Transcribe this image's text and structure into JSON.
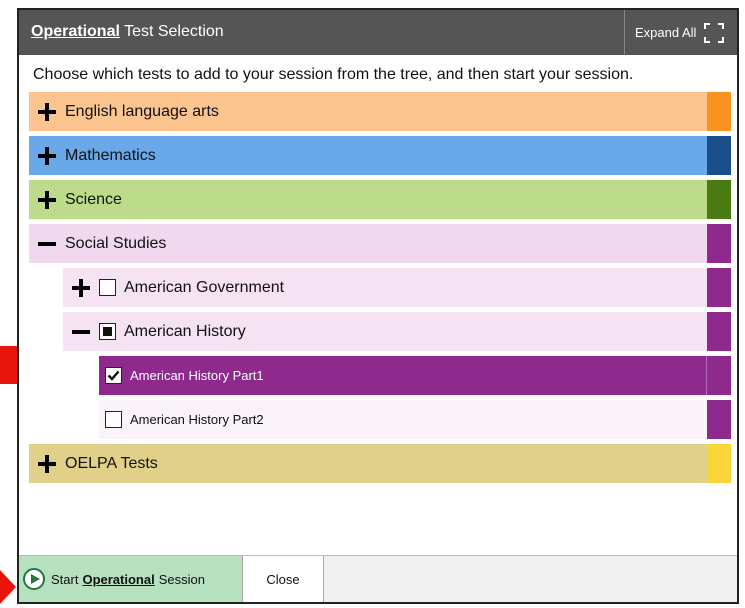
{
  "dialog": {
    "title_prefix": "Operational",
    "title_suffix": " Test Selection",
    "expand_all_label": "Expand All",
    "instructions": "Choose which tests to add to your session from the tree, and then start your session."
  },
  "tree": {
    "ela": {
      "label": "English language arts",
      "bg": "#fcc590",
      "accent": "#f7931e"
    },
    "math": {
      "label": "Mathematics",
      "bg": "#6aa9e9",
      "accent": "#1a4f8b"
    },
    "science": {
      "label": "Science",
      "bg": "#bcdc8c",
      "accent": "#4a7a12"
    },
    "social": {
      "label": "Social Studies",
      "bg": "#f0d9ee",
      "accent": "#8e2a8e"
    },
    "american_government": {
      "label": "American Government"
    },
    "american_history": {
      "label": "American History"
    },
    "ah_part1": {
      "label": "American History Part1",
      "selected_bg": "#8e2a8e"
    },
    "ah_part2": {
      "label": "American History Part2"
    },
    "oelpa": {
      "label": "OELPA Tests",
      "bg": "#e0d08a",
      "accent": "#f9d43a"
    }
  },
  "footer": {
    "start_prefix": "Start ",
    "start_emph": "Operational",
    "start_suffix": " Session",
    "close_label": "Close"
  },
  "colors": {
    "titlebar": "#555555",
    "arrow": "#e8150c",
    "start_bg": "#b7e0bf"
  }
}
